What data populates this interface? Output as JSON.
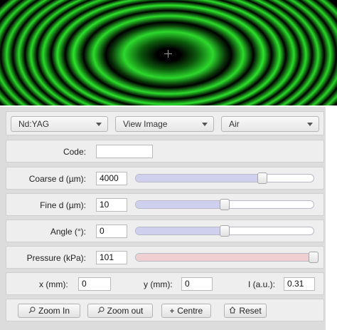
{
  "controls": {
    "laser_select": "Nd:YAG",
    "view_select": "View Image",
    "medium_select": "Air"
  },
  "code": {
    "label": "Code:",
    "value": ""
  },
  "coarse_d": {
    "label": "Coarse d (µm):",
    "value": "4000",
    "slider_fraction": 0.71,
    "track_color": "#cfcfee"
  },
  "fine_d": {
    "label": "Fine d (µm):",
    "value": "10",
    "slider_fraction": 0.5,
    "track_color": "#cfcfee"
  },
  "angle": {
    "label": "Angle (°):",
    "value": "0",
    "slider_fraction": 0.5,
    "track_color": "#cfcfee"
  },
  "pressure": {
    "label": "Pressure (kPa):",
    "value": "101",
    "slider_fraction": 1.0,
    "track_color": "#efcfcf"
  },
  "readout": {
    "x_label": "x (mm):",
    "x_value": "0",
    "y_label": "y (mm):",
    "y_value": "0",
    "i_label": "I (a.u.):",
    "i_value": "0.31"
  },
  "buttons": {
    "zoom_in": {
      "label": "Zoom In",
      "icon": "magnifier-icon"
    },
    "zoom_out": {
      "label": "Zoom out",
      "icon": "magnifier-icon"
    },
    "centre": {
      "label": "Centre",
      "icon": "plus-icon"
    },
    "reset": {
      "label": "Reset",
      "icon": "home-icon"
    }
  },
  "colors": {
    "fringe_green": "#2ad82a",
    "panel_bg": "#dcdcdc",
    "row_bg": "#eeeeee"
  }
}
